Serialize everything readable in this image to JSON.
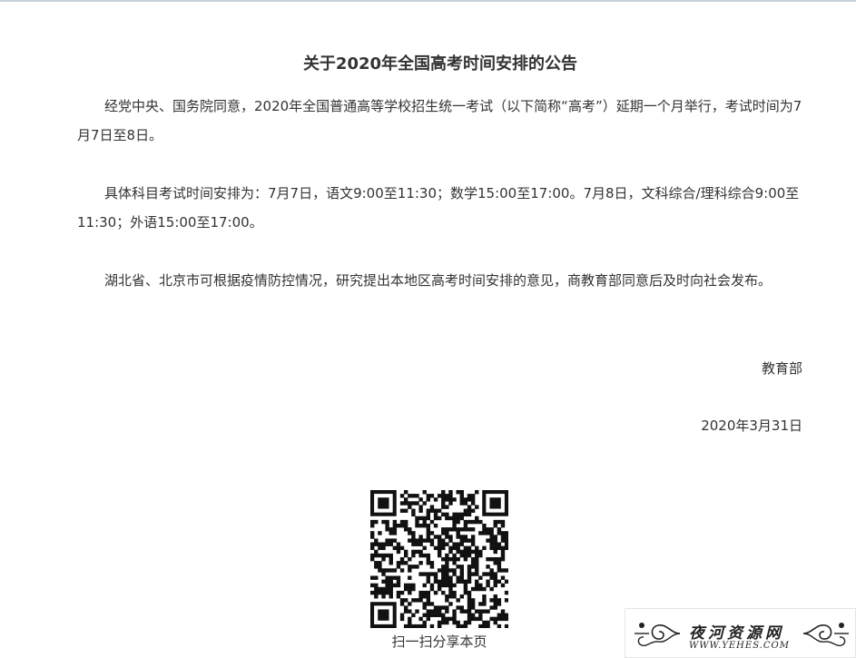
{
  "article": {
    "title": "关于2020年全国高考时间安排的公告",
    "paragraphs": [
      "经党中央、国务院同意，2020年全国普通高等学校招生统一考试（以下简称“高考”）延期一个月举行，考试时间为7月7日至8日。",
      "具体科目考试时间安排为：7月7日，语文9:00至11:30；数学15:00至17:00。7月8日，文科综合/理科综合9:00至11:30；外语15:00至17:00。",
      "湖北省、北京市可根据疫情防控情况，研究提出本地区高考时间安排的意见，商教育部同意后及时向社会发布。"
    ],
    "signature_org": "教育部",
    "signature_date": "2020年3月31日"
  },
  "share": {
    "qr_icon": "qr-code-icon",
    "caption": "扫一扫分享本页"
  },
  "watermark": {
    "name_cn": "夜河资源网",
    "url": "WWW.YEHES.COM"
  }
}
